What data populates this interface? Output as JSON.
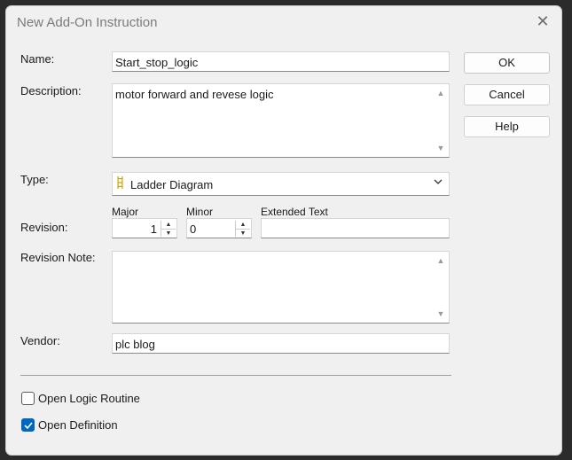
{
  "dialog": {
    "title": "New Add-On Instruction",
    "close_glyph": "✕"
  },
  "form": {
    "name_label": "Name:",
    "name_value": "Start_stop_logic",
    "description_label": "Description:",
    "description_value": "motor forward and revese logic",
    "type_label": "Type:",
    "type_value": "Ladder Diagram",
    "type_icon": "ladder-icon",
    "revision_label": "Revision:",
    "major_label": "Major",
    "major_value": "1",
    "minor_label": "Minor",
    "minor_value": "0",
    "extended_text_label": "Extended Text",
    "extended_text_value": "",
    "revision_note_label": "Revision Note:",
    "revision_note_value": "",
    "vendor_label": "Vendor:",
    "vendor_value": "plc blog"
  },
  "buttons": {
    "ok": "OK",
    "cancel": "Cancel",
    "help": "Help"
  },
  "options": {
    "open_logic_routine_label": "Open Logic Routine",
    "open_logic_routine_checked": false,
    "open_definition_label": "Open Definition",
    "open_definition_checked": true
  },
  "colors": {
    "accent": "#0067c0",
    "ladder_icon": "#c9a400"
  }
}
